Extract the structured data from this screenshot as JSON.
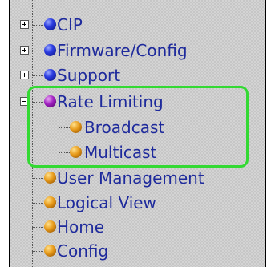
{
  "tree": {
    "items": [
      {
        "label": "CIP",
        "color": "blue",
        "expander": "plus"
      },
      {
        "label": "Firmware/Config",
        "color": "blue",
        "expander": "plus"
      },
      {
        "label": "Support",
        "color": "blue",
        "expander": "plus"
      },
      {
        "label": "Rate Limiting",
        "color": "purple",
        "expander": "minus",
        "children": [
          {
            "label": "Broadcast",
            "color": "orange"
          },
          {
            "label": "Multicast",
            "color": "orange"
          }
        ]
      },
      {
        "label": "User Management",
        "color": "orange"
      },
      {
        "label": "Logical View",
        "color": "orange"
      },
      {
        "label": "Home",
        "color": "orange"
      },
      {
        "label": "Config",
        "color": "orange"
      }
    ]
  },
  "highlight_color": "#33d933",
  "link_color": "#1e2a9c"
}
